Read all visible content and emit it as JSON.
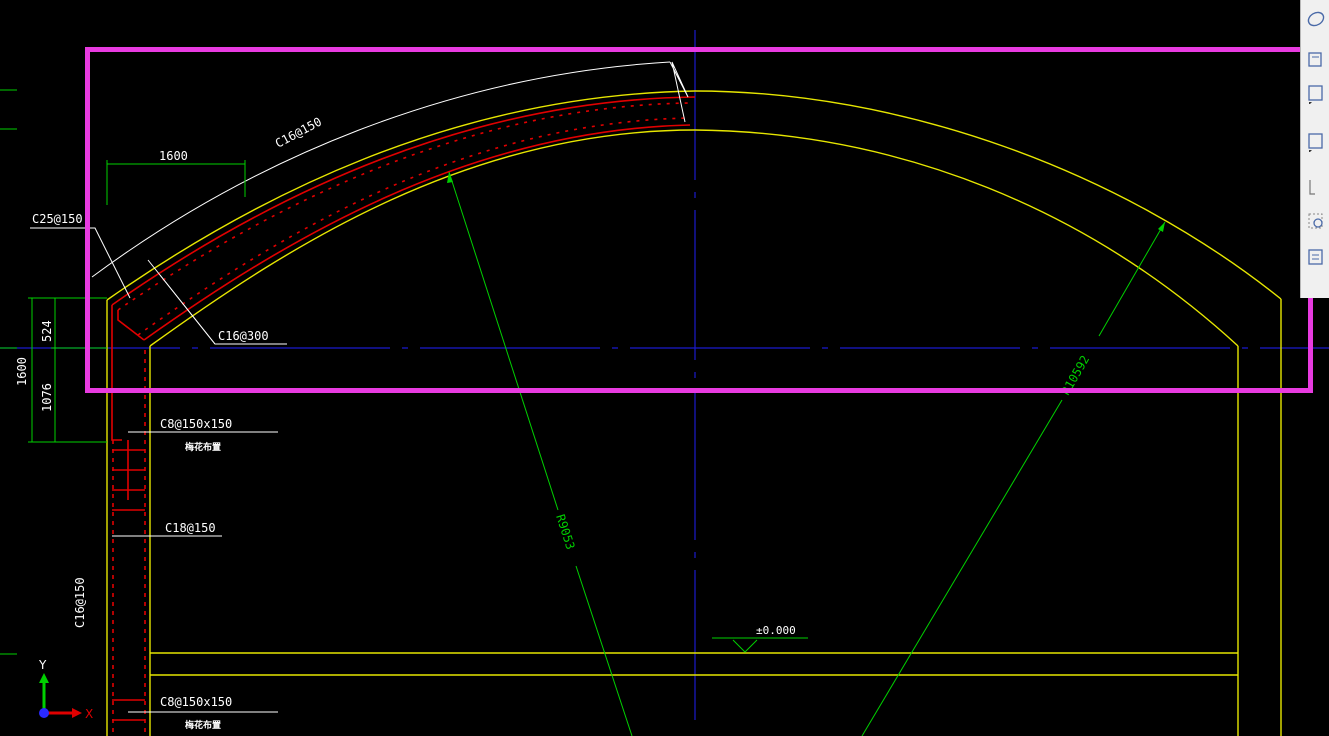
{
  "drawing": {
    "annotations": {
      "rebar_outer_arc": "C16@150",
      "rebar_corner": "C25@150",
      "rebar_haunch": "C16@300",
      "tie_upper": "C8@150x150",
      "tie_upper_note": "梅花布置",
      "wall_bar_inner": "C18@150",
      "wall_bar_outer": "C16@150",
      "tie_lower": "C8@150x150",
      "tie_lower_note": "梅花布置"
    },
    "dimensions": {
      "haunch_width": "1600",
      "haunch_height_upper": "524",
      "haunch_height_lower": "1076",
      "haunch_height_total": "1600",
      "inner_radius": "R9053",
      "outer_radius": "R10592"
    },
    "elevation": "±0.000",
    "ucs": {
      "y_axis": "Y",
      "x_axis": "X"
    }
  },
  "colors": {
    "background": "#000000",
    "concrete_outline": "#e6e600",
    "rebar": "#e00000",
    "dimension": "#00d000",
    "centerline": "#1a1acc",
    "leader": "#ffffff",
    "selection": "#e83be0"
  },
  "palette": {
    "tools": [
      "orbit-icon",
      "layer-icon",
      "block-icon",
      "block-icon",
      "dimension-icon",
      "settings-icon",
      "properties-icon"
    ]
  }
}
